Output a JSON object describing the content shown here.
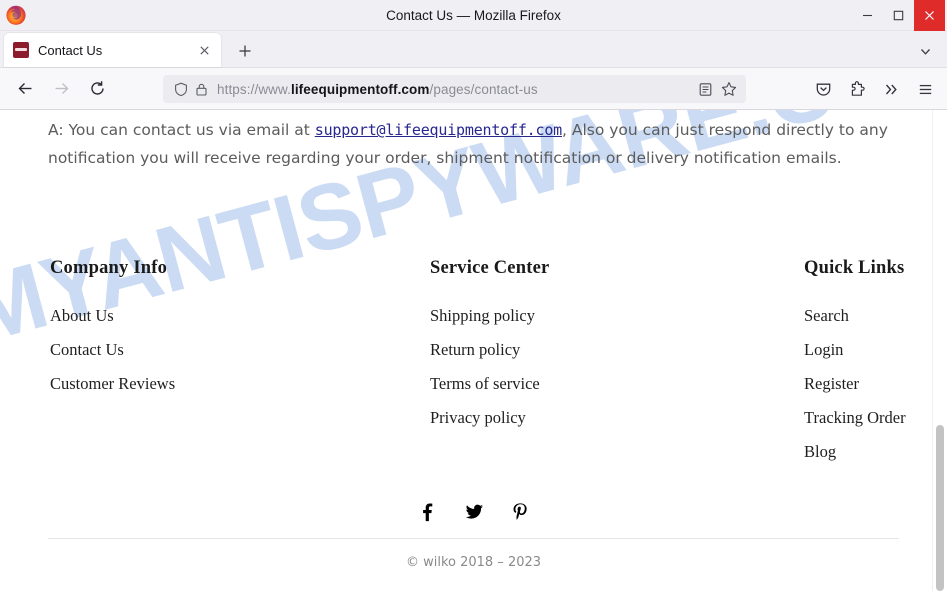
{
  "window": {
    "title": "Contact Us — Mozilla Firefox",
    "minimize_label": "Minimize",
    "maximize_label": "Maximize",
    "close_label": "Close",
    "app_icon": "firefox-logo"
  },
  "tabs": {
    "items": [
      {
        "title": "Contact Us",
        "favicon": "wilko-favicon",
        "close_label": "×",
        "active": true
      }
    ],
    "new_tab_label": "+",
    "list_all_tabs_label": "v"
  },
  "toolbar": {
    "back_label": "Back",
    "forward_label": "Forward",
    "reload_label": "Reload",
    "urlbar": {
      "shield_icon": "shield-icon",
      "lock_icon": "lock-icon",
      "prefix": "https://www.",
      "host": "lifeequipmentoff.com",
      "path": "/pages/contact-us",
      "full_url": "https://www.lifeequipmentoff.com/pages/contact-us",
      "reader_icon": "reader-mode-icon",
      "bookmark_icon": "bookmark-star-icon"
    },
    "pocket_label": "Pocket",
    "extensions_label": "Extensions",
    "overflow_label": "»",
    "menu_label": "Open application menu"
  },
  "page": {
    "watermark": "MYANTISPYWARE.COM",
    "watermark_color": "#c3d5f2",
    "answer": {
      "before_link": "A: You can contact us via email at ",
      "email": "support@lifeequipmentoff.com",
      "after_link": ", Also you can just respond directly to any notification you will receive regarding your order, shipment notification or delivery notification emails."
    },
    "footer": {
      "columns": [
        {
          "heading": "Company Info",
          "links": [
            "About Us",
            "Contact Us",
            "Customer Reviews"
          ]
        },
        {
          "heading": "Service Center",
          "links": [
            "Shipping policy",
            "Return policy",
            "Terms of service",
            "Privacy policy"
          ]
        },
        {
          "heading": "Quick Links",
          "links": [
            "Search",
            "Login",
            "Register",
            "Tracking Order",
            "Blog"
          ]
        }
      ],
      "social": [
        {
          "name": "facebook-icon",
          "label": "Facebook"
        },
        {
          "name": "twitter-icon",
          "label": "Twitter"
        },
        {
          "name": "pinterest-icon",
          "label": "Pinterest"
        }
      ],
      "copyright": "© wilko 2018 – 2023"
    }
  },
  "colors": {
    "close_button": "#e02b2b",
    "link_blue": "#27278f",
    "watermark_blue": "#c3d5f2",
    "favicon_red": "#8c1b2e"
  }
}
